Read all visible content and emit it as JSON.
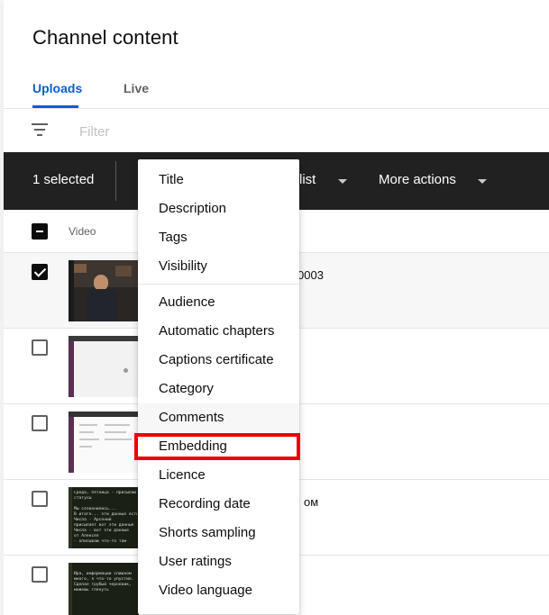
{
  "page": {
    "title": "Channel content"
  },
  "tabs": [
    {
      "label": "Uploads",
      "active": true
    },
    {
      "label": "Live",
      "active": false
    }
  ],
  "filter": {
    "placeholder": "Filter",
    "value": ""
  },
  "actionbar": {
    "selected_text": "1 selected",
    "playlist_label_partial": "list",
    "more_actions_label": "More actions"
  },
  "table": {
    "column_video": "Video",
    "rows": [
      {
        "selected": true,
        "text_fragment": "0003",
        "thumbnail": "video-thumbnail"
      },
      {
        "selected": false,
        "text_fragment": "",
        "thumbnail": "screen-recording-thumbnail"
      },
      {
        "selected": false,
        "text_fragment": "",
        "thumbnail": "screen-recording-thumbnail"
      },
      {
        "selected": false,
        "text_fragment": "ом",
        "thumbnail": "terminal-thumbnail",
        "thumb_text": "Среда, пятница - присылаю\nстатусы\n\nМы созвонились...\nВ итоге... эти данные есть\nЧисла - Арсений\nприсылает вот эти данные\nЧисла - вот эти данные\nот Алексея\n- описываю что-то там\n\nКак"
      },
      {
        "selected": false,
        "text_fragment": "",
        "thumbnail": "terminal-thumbnail",
        "thumb_text": "\nИра, информации слишком\nмного, я что-то упустил.\nСделал грубый черновик,\nможешь глянуть"
      }
    ]
  },
  "menu": {
    "group1": [
      "Title",
      "Description",
      "Tags",
      "Visibility"
    ],
    "group2": [
      "Audience",
      "Automatic chapters",
      "Captions certificate",
      "Category",
      "Comments",
      "Embedding",
      "Licence",
      "Recording date",
      "Shorts sampling",
      "User ratings",
      "Video language"
    ],
    "highlighted_item": "Embedding",
    "hovered_item": "Comments"
  },
  "colors": {
    "accent": "#065fd4",
    "actionbar": "#212121",
    "highlight": "#ee0000"
  }
}
